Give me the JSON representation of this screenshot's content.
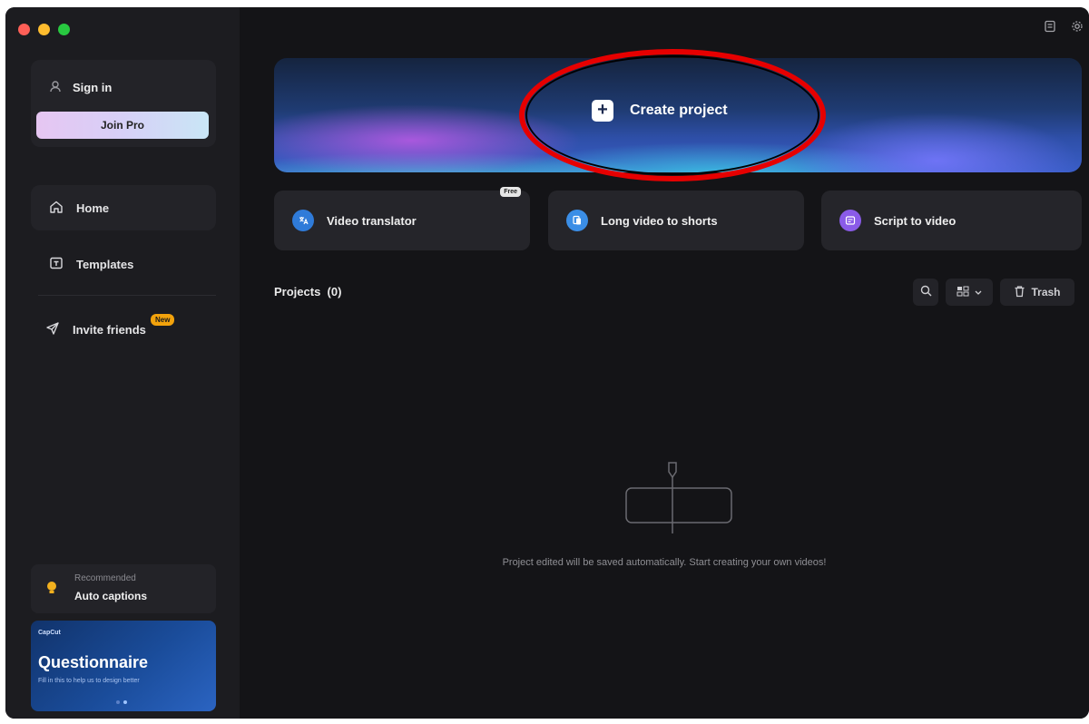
{
  "sidebar": {
    "sign_in": "Sign in",
    "join_pro": "Join Pro",
    "nav": [
      {
        "label": "Home",
        "icon": "home-icon"
      },
      {
        "label": "Templates",
        "icon": "templates-icon"
      },
      {
        "label": "Invite friends",
        "icon": "send-icon",
        "badge": "New"
      }
    ],
    "recommended": {
      "small": "Recommended",
      "title": "Auto captions"
    },
    "questionnaire": {
      "brand": "CapCut",
      "title": "Questionnaire",
      "subtitle": "Fill in this to help us to design better"
    }
  },
  "hero": {
    "label": "Create project"
  },
  "features": [
    {
      "label": "Video translator",
      "badge": "Free",
      "icon": "translate-icon"
    },
    {
      "label": "Long video to shorts",
      "icon": "shorts-icon"
    },
    {
      "label": "Script to video",
      "icon": "script-icon"
    }
  ],
  "projects": {
    "label": "Projects",
    "count": "(0)",
    "trash": "Trash",
    "empty_message": "Project edited will be saved automatically. Start creating your own videos!"
  },
  "colors": {
    "background": "#151518",
    "sidebar": "#1c1c20",
    "highlight": "#e60000",
    "badge_new": "#f2a20c"
  }
}
